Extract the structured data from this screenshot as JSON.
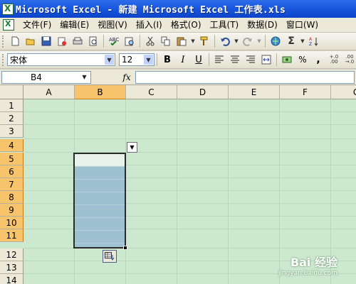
{
  "window": {
    "title": "Microsoft Excel - 新建 Microsoft Excel 工作表.xls"
  },
  "menu": {
    "items": [
      "文件(F)",
      "编辑(E)",
      "视图(V)",
      "插入(I)",
      "格式(O)",
      "工具(T)",
      "数据(D)",
      "窗口(W)"
    ]
  },
  "format_toolbar": {
    "font": "宋体",
    "size": "12",
    "bold": "B",
    "italic": "I",
    "underline": "U",
    "percent": "%",
    "comma": ",",
    "inc_decimal": "+.0\n.00",
    "dec_decimal": ".00\n+.0"
  },
  "formula_bar": {
    "cell_ref": "B4",
    "fx": "fx",
    "value": ""
  },
  "sheet": {
    "columns": [
      "A",
      "B",
      "C",
      "D",
      "E",
      "F",
      "G"
    ],
    "rows": [
      "1",
      "2",
      "3",
      "4",
      "5",
      "6",
      "7",
      "8",
      "9",
      "10",
      "11",
      "12",
      "13",
      "14"
    ],
    "selected_column": "B",
    "selected_rows": [
      "4",
      "5",
      "6",
      "7",
      "8",
      "9",
      "10",
      "11"
    ]
  },
  "colors": {
    "sheet_background": "#cce8cf",
    "selection": "#9ec1d2",
    "header_selected": "#f7c46b",
    "title_bar": "#0b44c9"
  },
  "watermark": {
    "main": "Bai 经验",
    "sub": "jingyan.baidu.com"
  }
}
